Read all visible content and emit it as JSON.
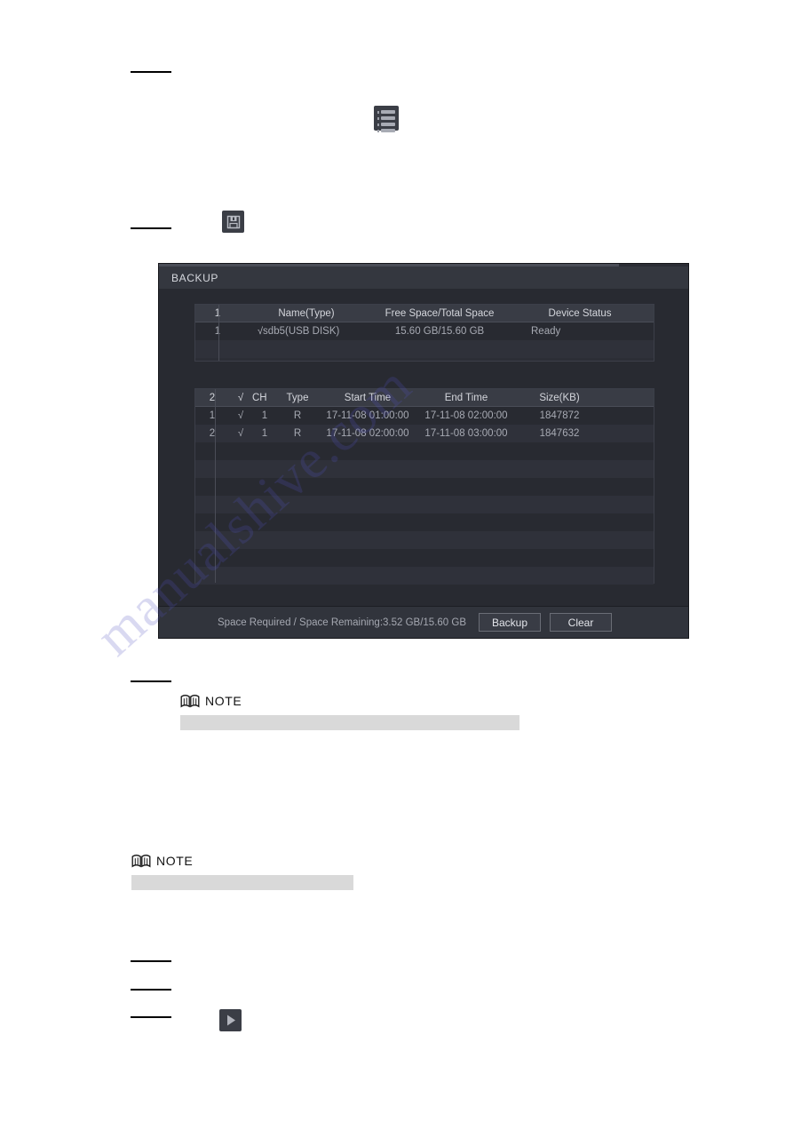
{
  "page": {
    "watermark_text": "manualshive.com",
    "redacted_step_rules": 6
  },
  "icons": {
    "list_icon_name": "list-icon",
    "save_icon_name": "save-floppy-icon",
    "play_icon_name": "play-icon",
    "note_icon_name": "open-book-icon"
  },
  "notes": [
    {
      "label": "NOTE"
    },
    {
      "label": "NOTE"
    }
  ],
  "dialog": {
    "title": "BACKUP",
    "device_table": {
      "headers": [
        "1",
        "Name(Type)",
        "Free Space/Total Space",
        "Device Status"
      ],
      "rows": [
        {
          "index": "1",
          "checked": true,
          "check_glyph": "√",
          "name": "sdb5(USB DISK)",
          "space": "15.60 GB/15.60 GB",
          "status": "Ready"
        }
      ],
      "empty_rows": 1
    },
    "file_table": {
      "headers": [
        "2",
        "√",
        "CH",
        "Type",
        "Start Time",
        "End Time",
        "Size(KB)"
      ],
      "rows": [
        {
          "index": "1",
          "check_glyph": "√",
          "ch": "1",
          "type": "R",
          "start_time": "17-11-08 01:00:00",
          "end_time": "17-11-08 02:00:00",
          "size": "1847872"
        },
        {
          "index": "2",
          "check_glyph": "√",
          "ch": "1",
          "type": "R",
          "start_time": "17-11-08 02:00:00",
          "end_time": "17-11-08 03:00:00",
          "size": "1847632"
        }
      ],
      "empty_rows": 9
    },
    "footer": {
      "space_text": "Space Required / Space Remaining:3.52 GB/15.60 GB",
      "backup_label": "Backup",
      "clear_label": "Clear"
    }
  },
  "colors": {
    "dialog_bg": "#282a31",
    "title_bg": "#34373f",
    "header_row_bg": "#393c45",
    "row_odd": "#2f313a",
    "row_even": "#282a31",
    "footer_bg": "#31343c",
    "text_primary": "#d4d6dc",
    "text_secondary": "#a7aab3",
    "note_redaction": "#d9d9d9"
  }
}
